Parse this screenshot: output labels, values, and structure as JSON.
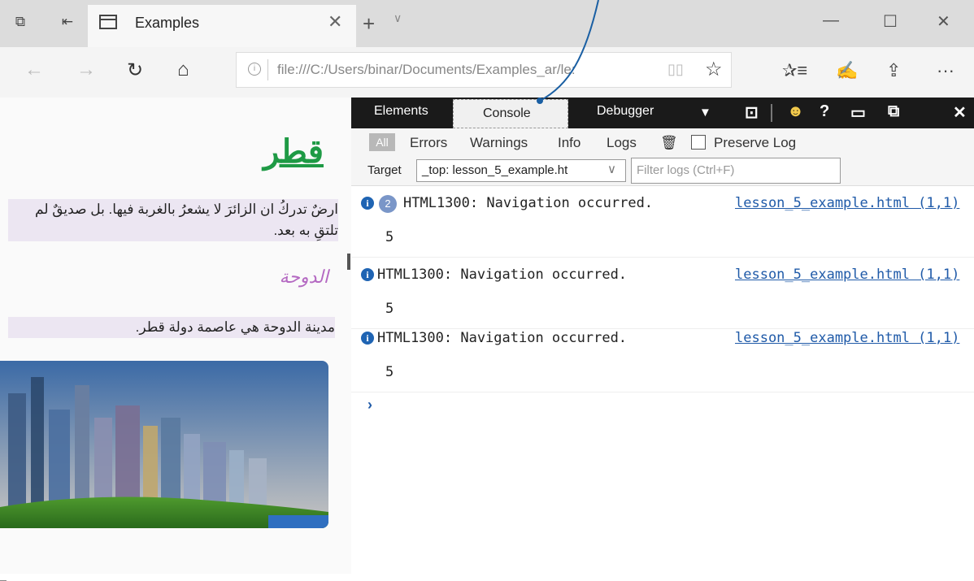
{
  "window": {
    "tab_title": "Examples",
    "tab_close": "✕",
    "new_tab": "+",
    "tab_dropdown": "∨",
    "minimize": "—",
    "maximize": "☐",
    "close": "✕"
  },
  "navbar": {
    "back": "←",
    "forward": "→",
    "refresh": "↻",
    "home": "⌂",
    "info_icon": "i",
    "url": "file:///C:/Users/binar/Documents/Examples_ar/le:",
    "reading_view": "▯▯",
    "favorite": "☆",
    "favorites_hub": "✰≡",
    "notes": "✍",
    "share": "⇪",
    "more": "···"
  },
  "page": {
    "heading": "قطر",
    "para1": "ارضٌ تدركُ ان الزائرَ لا يشعرُ بالغربة فيها. بل صديقٌ لم تلتقِ به بعد.",
    "subheading": "الدوحة",
    "para2": "مدينة الدوحة هي عاصمة دولة قطر."
  },
  "devtools": {
    "tabs": {
      "elements": "Elements",
      "console": "Console",
      "debugger": "Debugger"
    },
    "icons": {
      "dropdown": "▼",
      "console_icon": "⊡",
      "feedback": "☻",
      "help": "?",
      "dock": "▭",
      "undock": "⧉",
      "close": "✕"
    },
    "filters": {
      "all": "All",
      "errors": "Errors",
      "warnings": "Warnings",
      "info": "Info",
      "logs": "Logs",
      "clear": "🗑",
      "preserve_log": "Preserve Log"
    },
    "target_label": "Target",
    "target_value": "_top: lesson_5_example.ht",
    "target_chevron": "∨",
    "filter_placeholder": "Filter logs (Ctrl+F)",
    "logs": [
      {
        "count": "2",
        "message": "HTML1300: Navigation occurred.",
        "source": "lesson_5_example.html (1,1)",
        "value": "5"
      },
      {
        "count": "",
        "message": "HTML1300: Navigation occurred.",
        "source": "lesson_5_example.html (1,1)",
        "value": "5"
      },
      {
        "count": "",
        "message": "HTML1300: Navigation occurred.",
        "source": "lesson_5_example.html (1,1)",
        "value": "5"
      }
    ],
    "prompt": "›"
  },
  "colors": {
    "heading_green": "#1e9a45",
    "subheading_purple": "#b469c2",
    "devtools_bar": "#1a1a1a",
    "link_blue": "#1f5aa8",
    "callout_line": "#1a5fa3"
  }
}
